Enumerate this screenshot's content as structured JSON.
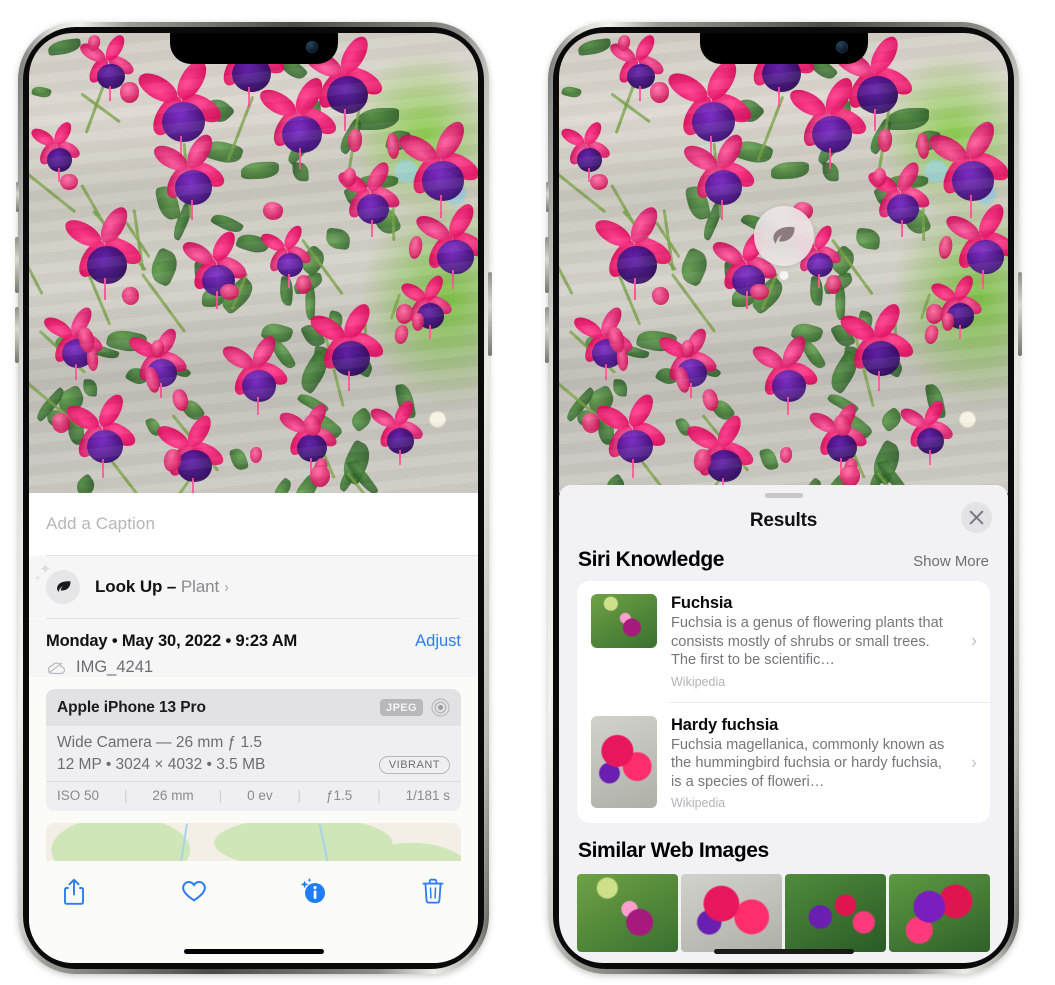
{
  "left_phone": {
    "caption": {
      "placeholder": "Add a Caption",
      "value": ""
    },
    "look_up": {
      "label": "Look Up – ",
      "subject": "Plant",
      "icon": "leaf-icon",
      "chevron": "›"
    },
    "info": {
      "date": "Monday • May 30, 2022 • 9:23 AM",
      "adjust_label": "Adjust",
      "filename": "IMG_4241",
      "cloud_icon": "icloud-slash-icon"
    },
    "camera_card": {
      "device": "Apple iPhone 13 Pro",
      "format_badge": "JPEG",
      "hdr_icon": "hdr-target-icon",
      "lens": "Wide Camera — 26 mm ƒ 1.5",
      "specs": "12 MP • 3024 × 4032 • 3.5 MB",
      "style_badge": "VIBRANT",
      "exif": [
        "ISO 50",
        "26 mm",
        "0 ev",
        "ƒ1.5",
        "1/181 s"
      ]
    },
    "toolbar": [
      {
        "name": "share-icon",
        "label": "Share"
      },
      {
        "name": "heart-icon",
        "label": "Favorite"
      },
      {
        "name": "info-sparkle-icon",
        "label": "Info"
      },
      {
        "name": "trash-icon",
        "label": "Delete"
      }
    ]
  },
  "right_phone": {
    "vlu_badge": {
      "icon": "leaf-icon",
      "label": "Visual Look Up"
    },
    "results": {
      "title": "Results",
      "close_icon": "close-icon",
      "siri_knowledge": {
        "heading": "Siri Knowledge",
        "show_more": "Show More",
        "items": [
          {
            "title": "Fuchsia",
            "description": "Fuchsia is a genus of flowering plants that consists mostly of shrubs or small trees. The first to be scientific…",
            "source": "Wikipedia",
            "chevron": "›"
          },
          {
            "title": "Hardy fuchsia",
            "description": "Fuchsia magellanica, commonly known as the hummingbird fuchsia or hardy fuchsia, is a species of floweri…",
            "source": "Wikipedia",
            "chevron": "›"
          }
        ]
      },
      "similar_web_images": {
        "heading": "Similar Web Images",
        "thumbnails": [
          "fuchsia-thumb-1",
          "fuchsia-thumb-2",
          "fuchsia-thumb-3",
          "fuchsia-thumb-4"
        ]
      }
    }
  },
  "colors": {
    "accent_blue": "#2a7cf6",
    "sheet_bg": "#f6f6f7",
    "results_bg": "#f2f2f6",
    "card_white": "#ffffff"
  }
}
